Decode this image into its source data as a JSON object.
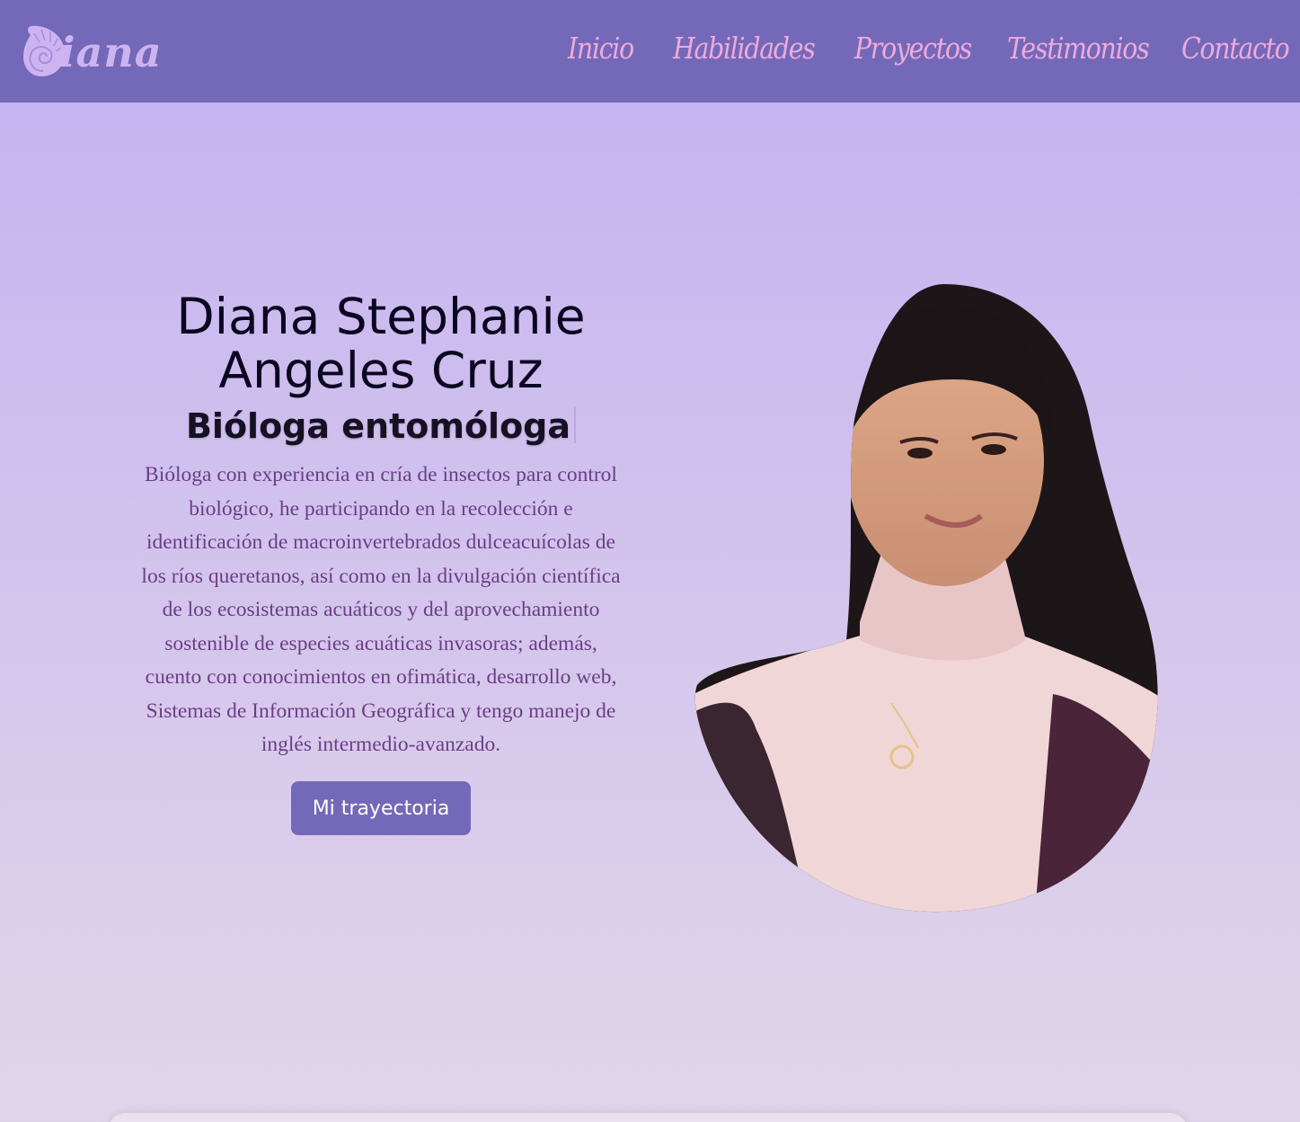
{
  "brand": {
    "logo_text": "iana",
    "logo_icon": "ammonite-shell-icon"
  },
  "nav": {
    "items": [
      {
        "label": "Inicio"
      },
      {
        "label": "Habilidades"
      },
      {
        "label": "Proyectos"
      },
      {
        "label": "Testimonios"
      },
      {
        "label": "Contacto"
      }
    ]
  },
  "hero": {
    "name_line1": "Diana Stephanie",
    "name_line2": "Angeles Cruz",
    "role": "Bióloga entomóloga",
    "description": "Bióloga con experiencia en cría de insectos para control biológico, he participando en la recolección e identificación de macroinvertebrados dulceacuícolas de los ríos queretanos, así como en la divulgación científica de los ecosistemas acuáticos y del aprovechamiento sostenible de especies acuáticas invasoras; además, cuento con conocimientos en ofimática, desarrollo web, Sistemas de Información Geográfica y tengo manejo de inglés intermedio-avanzado.",
    "button_label": "Mi trayectoria",
    "portrait_alt": "profile-photo"
  },
  "colors": {
    "navbar": "#7469b8",
    "nav_link": "#eeaadd",
    "logo": "#cdb3f2",
    "description_text": "#6a3e86",
    "button": "#7469b8"
  }
}
